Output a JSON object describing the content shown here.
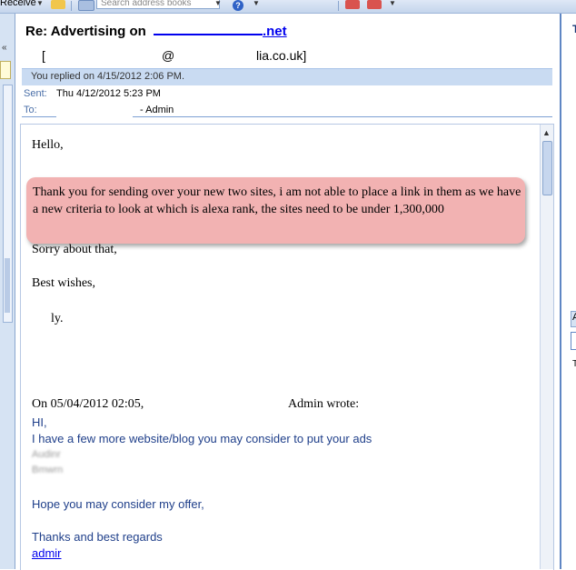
{
  "toolbar": {
    "receive_label": "Receive",
    "search_placeholder": "Search address books",
    "help_label": "?"
  },
  "message": {
    "subject_prefix": "Re: Advertising on",
    "subject_link": ".net",
    "sender_partial": "lia.co.uk]",
    "sender_bracket": "[",
    "sender_at": "@",
    "replied_notice": "You replied on 4/15/2012 2:06 PM.",
    "sent_label": "Sent:",
    "sent_value": "Thu 4/12/2012 5:23 PM",
    "to_label": "To:",
    "to_value": "- Admin"
  },
  "body": {
    "greeting": "Hello,",
    "highlighted_text": "Thank you for sending over your new two sites, i am not able to place a link in them as we have a new criteria to look at which is alexa rank, the sites need to be under 1,300,000",
    "apology": "Sorry about that,",
    "signoff": "Best wishes,",
    "signature_partial": "ly.",
    "quote_header_start": "On 05/04/2012 02:05,",
    "quote_header_end": "Admin wrote:",
    "quote_hi": "HI,",
    "quote_line1": "I have a few more website/blog you may consider to put your ads",
    "quote_blur1": "Audinr",
    "quote_blur2": "Bmwrn",
    "quote_line2": "Hope you may consider my offer,",
    "quote_line3": "Thanks and best regards",
    "quote_link": "admir"
  },
  "right_pane": {
    "letter_top": "T",
    "letter_mid": "A",
    "letter_low": "T"
  },
  "colors": {
    "highlight": "#f2b2b2",
    "replied_bar": "#c9dbf2",
    "quote_text": "#1f3f8a",
    "link": "#0000ee"
  }
}
